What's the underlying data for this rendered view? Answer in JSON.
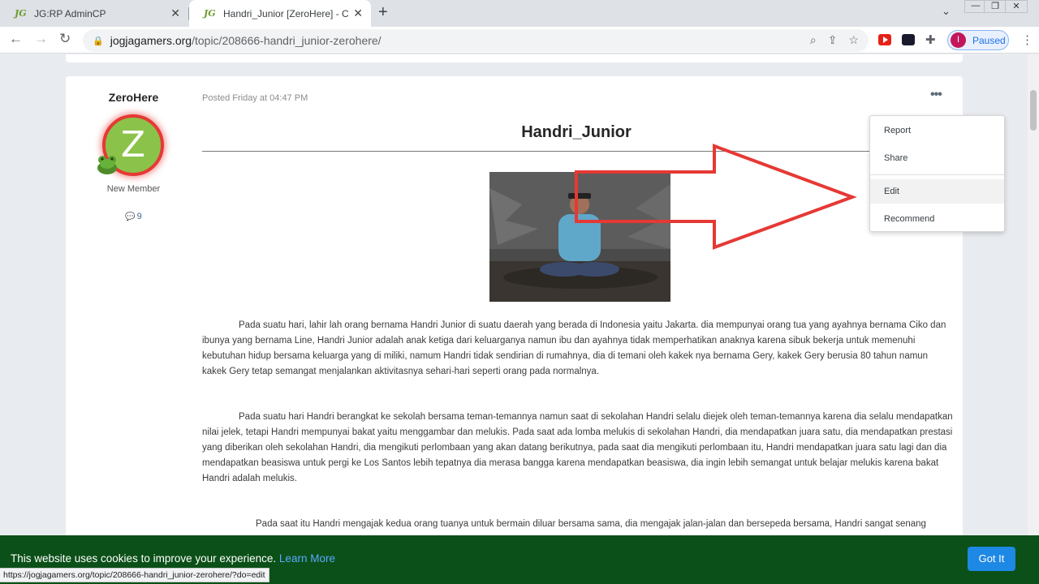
{
  "browser": {
    "tabs": [
      {
        "title": "JG:RP AdminCP",
        "favicon": "JG"
      },
      {
        "title": "Handri_Junior [ZeroHere] - Characte",
        "favicon": "JG"
      }
    ],
    "url_host": "jogjagamers.org",
    "url_path": "/topic/208666-handri_junior-zerohere/",
    "profile_initial": "I",
    "profile_status": "Paused"
  },
  "post": {
    "author": "ZeroHere",
    "avatar_letter": "Z",
    "rank": "New Member",
    "post_count": "9",
    "posted": "Posted Friday at 04:47 PM",
    "title": "Handri_Junior",
    "paragraphs": [
      "Pada suatu hari, lahir lah orang bernama Handri Junior di suatu daerah yang berada di Indonesia yaitu Jakarta. dia mempunyai orang tua yang ayahnya bernama Ciko dan ibunya yang bernama Line, Handri Junior adalah anak ketiga dari keluarganya namun ibu dan ayahnya tidak memperhatikan anaknya karena sibuk bekerja untuk memenuhi kebutuhan hidup bersama keluarga yang di miliki, namum Handri tidak sendirian di rumahnya, dia di temani oleh kakek nya bernama Gery, kakek Gery berusia 80 tahun namun kakek Gery tetap semangat menjalankan aktivitasnya sehari-hari seperti orang pada normalnya.",
      "Pada suatu hari Handri berangkat ke sekolah bersama teman-temannya namun saat di sekolahan Handri selalu diejek oleh teman-temannya karena dia selalu mendapatkan nilai jelek, tetapi Handri mempunyai bakat yaitu menggambar dan melukis. Pada saat ada lomba melukis di sekolahan Handri, dia mendapatkan juara satu, dia mendapatkan prestasi yang diberikan oleh sekolahan Handri, dia mengikuti perlombaan yang akan datang berikutnya, pada saat dia mengikuti perlombaan itu, Handri mendapatkan juara satu lagi dan dia mendapatkan beasiswa untuk pergi ke Los Santos lebih tepatnya dia merasa bangga karena mendapatkan beasiswa, dia ingin lebih semangat untuk belajar melukis karena bakat Handri adalah melukis.",
      "Pada saat itu Handri mengajak kedua orang tuanya untuk bermain diluar bersama sama, dia mengajak jalan-jalan dan bersepeda bersama, Handri sangat senang"
    ]
  },
  "menu": {
    "items": [
      "Report",
      "Share",
      "Edit",
      "Recommend"
    ]
  },
  "cookie": {
    "message": "This website uses cookies to improve your experience.",
    "learn_more": "Learn More",
    "button": "Got It"
  },
  "status_url": "https://jogjagamers.org/topic/208666-handri_junior-zerohere/?do=edit",
  "colors": {
    "annotation_arrow": "#e53935",
    "cookie_bg": "#0b5018",
    "accent": "#1e88e5"
  }
}
